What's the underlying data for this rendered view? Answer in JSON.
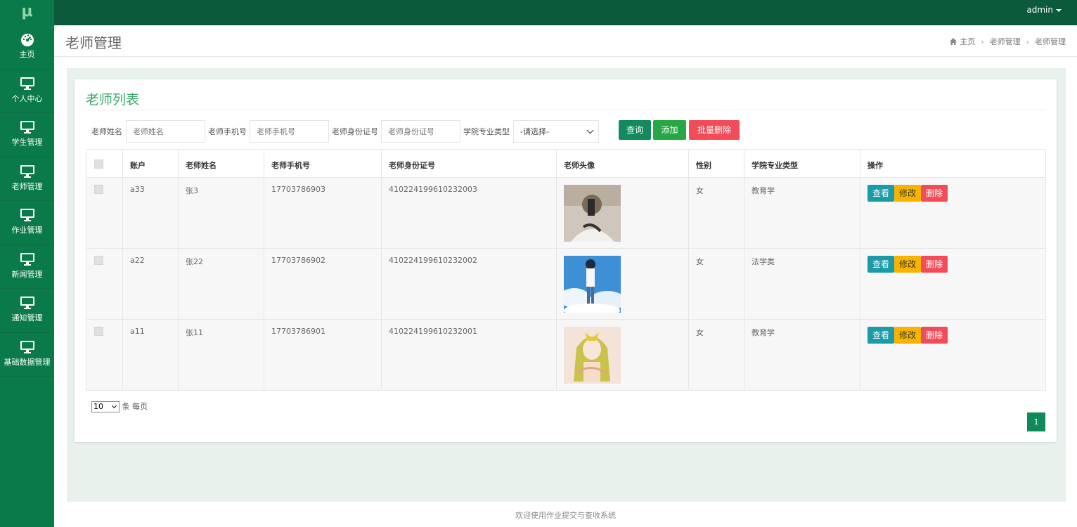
{
  "topbar": {
    "logo": "μ",
    "user": "admin"
  },
  "sidebar": {
    "items": [
      {
        "label": "主页",
        "icon": "dashboard-icon"
      },
      {
        "label": "个人中心",
        "icon": "monitor-icon"
      },
      {
        "label": "学生管理",
        "icon": "monitor-icon"
      },
      {
        "label": "老师管理",
        "icon": "monitor-icon"
      },
      {
        "label": "作业管理",
        "icon": "monitor-icon"
      },
      {
        "label": "新闻管理",
        "icon": "monitor-icon"
      },
      {
        "label": "通知管理",
        "icon": "monitor-icon"
      },
      {
        "label": "基础数据管理",
        "icon": "monitor-icon"
      }
    ]
  },
  "header": {
    "title": "老师管理",
    "breadcrumb": [
      "主页",
      "老师管理",
      "老师管理"
    ]
  },
  "panel": {
    "title": "老师列表",
    "search": {
      "name_label": "老师姓名",
      "name_placeholder": "老师姓名",
      "phone_label": "老师手机号",
      "phone_placeholder": "老师手机号",
      "idcard_label": "老师身份证号",
      "idcard_placeholder": "老师身份证号",
      "major_label": "学院专业类型",
      "major_selected": "-请选择-"
    },
    "buttons": {
      "query": "查询",
      "add": "添加",
      "batch_delete": "批量删除"
    }
  },
  "table": {
    "headers": [
      "账户",
      "老师姓名",
      "老师手机号",
      "老师身份证号",
      "老师头像",
      "性别",
      "学院专业类型",
      "操作"
    ],
    "rows": [
      {
        "account": "a33",
        "name": "张3",
        "phone": "17703786903",
        "idcard": "410224199610232003",
        "gender": "女",
        "major": "教育学"
      },
      {
        "account": "a22",
        "name": "张22",
        "phone": "17703786902",
        "idcard": "410224199610232002",
        "gender": "女",
        "major": "法学类"
      },
      {
        "account": "a11",
        "name": "张11",
        "phone": "17703786901",
        "idcard": "410224199610232001",
        "gender": "女",
        "major": "教育学"
      }
    ],
    "actions": {
      "view": "查看",
      "edit": "修改",
      "delete": "删除"
    }
  },
  "pagination": {
    "page_size": "10",
    "per_page_label": "条 每页",
    "current_page": "1"
  },
  "footer": {
    "text": "欢迎使用作业提交与查收系统"
  },
  "colors": {
    "sidebar": "#0a7a4a",
    "topbar": "#0b5a3b",
    "accent_green": "#3aa76b",
    "view": "#1b9aa8",
    "edit": "#f6b400",
    "delete": "#f24c58"
  }
}
